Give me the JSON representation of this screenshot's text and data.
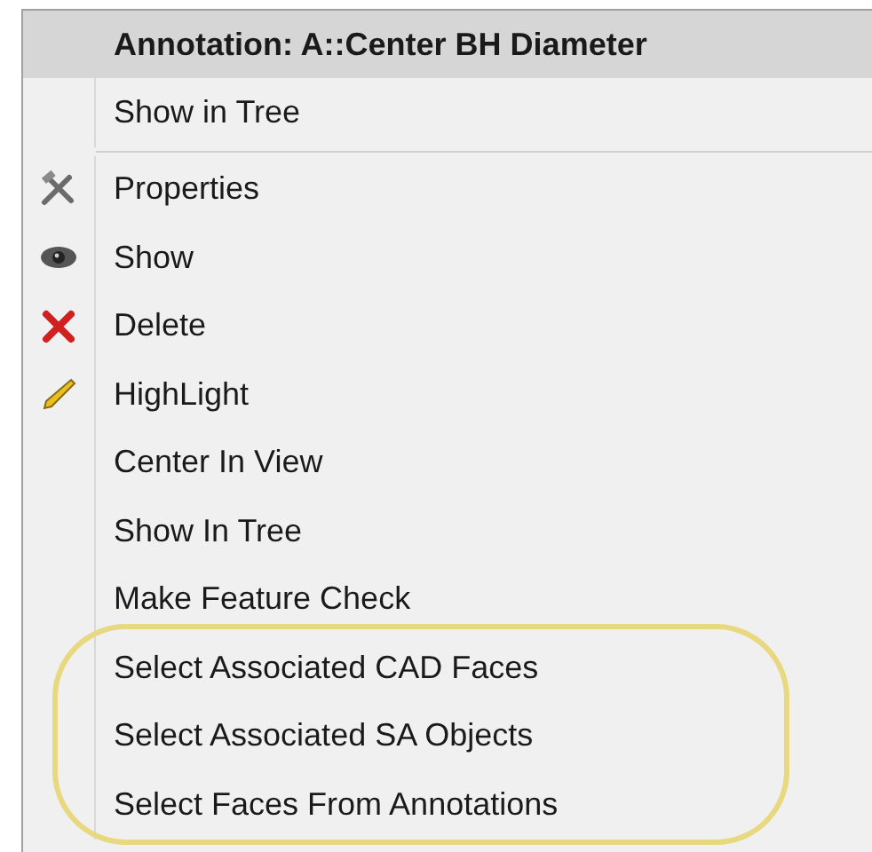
{
  "menu": {
    "header": "Annotation: A::Center BH Diameter",
    "top_items": [
      {
        "label": "Show in Tree"
      }
    ],
    "items": [
      {
        "label": "Properties",
        "kind": "tools",
        "circled": false
      },
      {
        "label": "Show",
        "kind": "eye",
        "circled": false
      },
      {
        "label": "Delete",
        "kind": "cross",
        "circled": false
      },
      {
        "label": "HighLight",
        "kind": "pencil",
        "circled": false
      },
      {
        "label": "Center In View",
        "kind": "none",
        "circled": false
      },
      {
        "label": "Show In Tree",
        "kind": "none",
        "circled": false
      },
      {
        "label": "Make Feature Check",
        "kind": "none",
        "circled": false
      },
      {
        "label": "Select Associated CAD Faces",
        "kind": "none",
        "circled": true
      },
      {
        "label": "Select Associated SA Objects",
        "kind": "none",
        "circled": true
      },
      {
        "label": "Select Faces From Annotations",
        "kind": "none",
        "circled": true
      }
    ]
  }
}
